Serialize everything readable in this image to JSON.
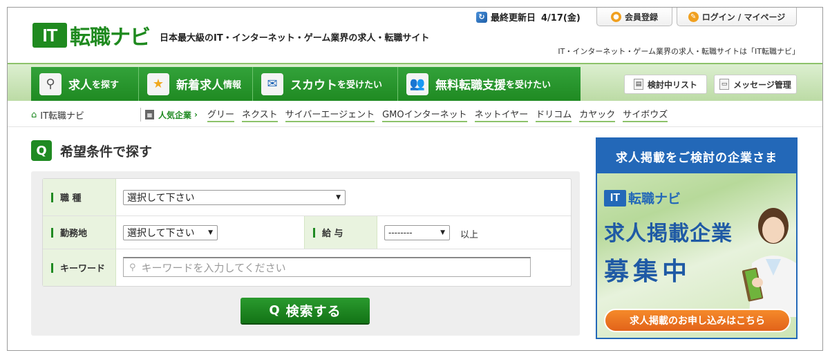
{
  "header": {
    "logo_it": "IT",
    "logo_text": "転職ナビ",
    "tagline": "日本最大級のIT・インターネット・ゲーム業界の求人・転職サイト",
    "updated_label": "最終更新日",
    "updated_date": "4/17(金)",
    "register_label": "会員登録",
    "login_label": "ログイン / マイページ",
    "subtag": "IT・インターネット・ゲーム業界の求人・転職サイトは「IT転職ナビ」"
  },
  "nav": {
    "items": [
      {
        "main": "求人",
        "sub": "を探す"
      },
      {
        "main": "新着求人",
        "sub": "情報"
      },
      {
        "main": "スカウト",
        "sub": "を受けたい"
      },
      {
        "main": "無料転職支援",
        "sub": "を受けたい"
      }
    ],
    "considering_label": "検討中リスト",
    "message_label": "メッセージ管理"
  },
  "breadcrumb": {
    "home": "IT転職ナビ",
    "popular_label": "人気企業",
    "companies": [
      "グリー",
      "ネクスト",
      "サイバーエージェント",
      "GMOインターネット",
      "ネットイヤー",
      "ドリコム",
      "カヤック",
      "サイボウズ"
    ]
  },
  "search": {
    "title": "希望条件で探す",
    "job_label": "職 種",
    "job_value": "選択して下さい",
    "location_label": "勤務地",
    "location_value": "選択して下さい",
    "salary_label": "給 与",
    "salary_value": "--------",
    "salary_suffix": "以上",
    "keyword_label": "キーワード",
    "keyword_placeholder": "キーワードを入力してください",
    "button_label": "検索する"
  },
  "ad": {
    "top": "求人掲載をご検討の企業さま",
    "logo_it": "IT",
    "logo_text": "転職ナビ",
    "line1": "求人掲載企業",
    "line2": "募集中",
    "cta": "求人掲載のお申し込みはこちら"
  }
}
